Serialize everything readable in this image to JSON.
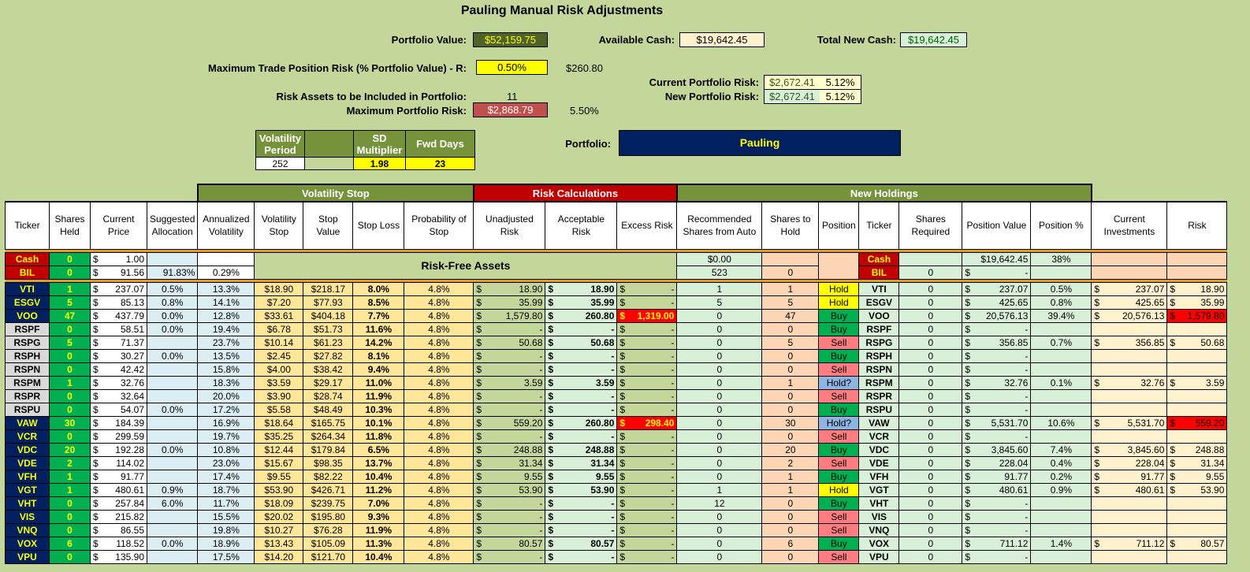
{
  "title": "Pauling Manual Risk Adjustments",
  "colors": {
    "bg": "#c4d79b",
    "dark_green": "#76933c",
    "red": "#c00000",
    "navy": "#002060",
    "yellow": "#ffff00"
  },
  "header": {
    "portfolio_value_label": "Portfolio Value:",
    "portfolio_value": "$52,159.75",
    "available_cash_label": "Available Cash:",
    "available_cash": "$19,642.45",
    "total_new_cash_label": "Total New Cash:",
    "total_new_cash": "$19,642.45",
    "max_trade_label": "Maximum Trade Position Risk (% Portfolio Value) - R:",
    "max_trade_pct": "0.50%",
    "max_trade_amt": "$260.80",
    "current_risk_label": "Current Portfolio Risk:",
    "current_risk": "$2,672.41",
    "current_risk_pct": "5.12%",
    "new_risk_label": "New Portfolio Risk:",
    "new_risk": "$2,672.41",
    "new_risk_pct": "5.12%",
    "risk_assets_label": "Risk Assets to be Included in Portfolio:",
    "risk_assets": "11",
    "max_portfolio_risk_label": "Maximum Portfolio Risk:",
    "max_portfolio_risk": "$2,868.79",
    "max_portfolio_risk_pct": "5.50%",
    "portfolio_label": "Portfolio:",
    "portfolio_name": "Pauling"
  },
  "vol_params": {
    "h1": "Volatility Period",
    "h2": "",
    "h3": "SD Multiplier",
    "h4": "Fwd Days",
    "v1": "252",
    "v2": "",
    "v3": "1.98",
    "v4": "23"
  },
  "groups": {
    "vol_stop": "Volatility Stop",
    "risk_calc": "Risk Calculations",
    "new_holdings": "New Holdings",
    "risk_free": "Risk-Free Assets"
  },
  "columns": [
    "Ticker",
    "Shares Held",
    "Current Price",
    "Suggested Allocation",
    "Annualized Volatility",
    "Volatility Stop",
    "Stop Value",
    "Stop Loss",
    "Probability of Stop",
    "Unadjusted Risk",
    "Acceptable Risk",
    "Excess Risk",
    "Recommended Shares from Auto",
    "Shares to Hold",
    "Position",
    "Ticker",
    "Shares Required",
    "Position Value",
    "Position %",
    "Current Investments",
    "Risk"
  ],
  "cash_row": {
    "ticker": "Cash",
    "held": "0",
    "price": "1.00",
    "rec": "$0.00",
    "pos_value": "$19,642.45",
    "pos_pct": "38%"
  },
  "bil_row": {
    "ticker": "BIL",
    "held": "0",
    "price": "91.56",
    "alloc": "91.83%",
    "vol": "0.29%",
    "rec": "523",
    "hold": "0",
    "req": "0",
    "pos_value": "-"
  },
  "dollar": "$",
  "rows": [
    {
      "t": "VTI",
      "h": "1",
      "p": "237.07",
      "a": "0.5%",
      "v": "13.3%",
      "vs": "$18.90",
      "sv": "$218.17",
      "sl": "8.0%",
      "ps": "4.8%",
      "ur": "18.90",
      "ar": "18.90",
      "er": "-",
      "rs": "1",
      "sh": "1",
      "pos": "Hold",
      "req": "0",
      "pv": "237.07",
      "pp": "0.5%",
      "ci": "237.07",
      "rk": "18.90"
    },
    {
      "t": "ESGV",
      "h": "5",
      "p": "85.13",
      "a": "0.8%",
      "v": "14.1%",
      "vs": "$7.20",
      "sv": "$77.93",
      "sl": "8.5%",
      "ps": "4.8%",
      "ur": "35.99",
      "ar": "35.99",
      "er": "-",
      "rs": "5",
      "sh": "5",
      "pos": "Hold",
      "req": "0",
      "pv": "425.65",
      "pp": "0.8%",
      "ci": "425.65",
      "rk": "35.99"
    },
    {
      "t": "VOO",
      "h": "47",
      "p": "437.79",
      "a": "0.0%",
      "v": "12.8%",
      "vs": "$33.61",
      "sv": "$404.18",
      "sl": "7.7%",
      "ps": "4.8%",
      "ur": "1,579.80",
      "ar": "260.80",
      "er": "1,319.00",
      "rs": "0",
      "sh": "47",
      "pos": "Buy",
      "req": "0",
      "pv": "20,576.13",
      "pp": "39.4%",
      "ci": "20,576.13",
      "rk": "1,579.80"
    },
    {
      "t": "RSPF",
      "h": "0",
      "p": "58.51",
      "a": "0.0%",
      "v": "19.4%",
      "vs": "$6.78",
      "sv": "$51.73",
      "sl": "11.6%",
      "ps": "4.8%",
      "ur": "-",
      "ar": "-",
      "er": "-",
      "rs": "0",
      "sh": "0",
      "pos": "Buy",
      "req": "0",
      "pv": "-",
      "pp": "",
      "ci": "",
      "rk": ""
    },
    {
      "t": "RSPG",
      "h": "5",
      "p": "71.37",
      "a": "",
      "v": "23.7%",
      "vs": "$10.14",
      "sv": "$61.23",
      "sl": "14.2%",
      "ps": "4.8%",
      "ur": "50.68",
      "ar": "50.68",
      "er": "-",
      "rs": "0",
      "sh": "5",
      "pos": "Sell",
      "req": "0",
      "pv": "356.85",
      "pp": "0.7%",
      "ci": "356.85",
      "rk": "50.68"
    },
    {
      "t": "RSPH",
      "h": "0",
      "p": "30.27",
      "a": "0.0%",
      "v": "13.5%",
      "vs": "$2.45",
      "sv": "$27.82",
      "sl": "8.1%",
      "ps": "4.8%",
      "ur": "-",
      "ar": "-",
      "er": "-",
      "rs": "0",
      "sh": "0",
      "pos": "Buy",
      "req": "0",
      "pv": "-",
      "pp": "",
      "ci": "",
      "rk": ""
    },
    {
      "t": "RSPN",
      "h": "0",
      "p": "42.42",
      "a": "",
      "v": "15.8%",
      "vs": "$4.00",
      "sv": "$38.42",
      "sl": "9.4%",
      "ps": "4.8%",
      "ur": "-",
      "ar": "-",
      "er": "-",
      "rs": "0",
      "sh": "0",
      "pos": "Sell",
      "req": "0",
      "pv": "-",
      "pp": "",
      "ci": "",
      "rk": ""
    },
    {
      "t": "RSPM",
      "h": "1",
      "p": "32.76",
      "a": "",
      "v": "18.3%",
      "vs": "$3.59",
      "sv": "$29.17",
      "sl": "11.0%",
      "ps": "4.8%",
      "ur": "3.59",
      "ar": "3.59",
      "er": "-",
      "rs": "0",
      "sh": "1",
      "pos": "Hold?",
      "req": "0",
      "pv": "32.76",
      "pp": "0.1%",
      "ci": "32.76",
      "rk": "3.59"
    },
    {
      "t": "RSPR",
      "h": "0",
      "p": "32.64",
      "a": "",
      "v": "20.0%",
      "vs": "$3.90",
      "sv": "$28.74",
      "sl": "11.9%",
      "ps": "4.8%",
      "ur": "-",
      "ar": "-",
      "er": "-",
      "rs": "0",
      "sh": "0",
      "pos": "Sell",
      "req": "0",
      "pv": "-",
      "pp": "",
      "ci": "",
      "rk": ""
    },
    {
      "t": "RSPU",
      "h": "0",
      "p": "54.07",
      "a": "0.0%",
      "v": "17.2%",
      "vs": "$5.58",
      "sv": "$48.49",
      "sl": "10.3%",
      "ps": "4.8%",
      "ur": "-",
      "ar": "-",
      "er": "-",
      "rs": "0",
      "sh": "0",
      "pos": "Buy",
      "req": "0",
      "pv": "-",
      "pp": "",
      "ci": "",
      "rk": ""
    },
    {
      "t": "VAW",
      "h": "30",
      "p": "184.39",
      "a": "",
      "v": "16.9%",
      "vs": "$18.64",
      "sv": "$165.75",
      "sl": "10.1%",
      "ps": "4.8%",
      "ur": "559.20",
      "ar": "260.80",
      "er": "298.40",
      "rs": "0",
      "sh": "30",
      "pos": "Hold?",
      "req": "0",
      "pv": "5,531.70",
      "pp": "10.6%",
      "ci": "5,531.70",
      "rk": "559.20"
    },
    {
      "t": "VCR",
      "h": "0",
      "p": "299.59",
      "a": "",
      "v": "19.7%",
      "vs": "$35.25",
      "sv": "$264.34",
      "sl": "11.8%",
      "ps": "4.8%",
      "ur": "-",
      "ar": "-",
      "er": "-",
      "rs": "0",
      "sh": "0",
      "pos": "Sell",
      "req": "0",
      "pv": "-",
      "pp": "",
      "ci": "",
      "rk": ""
    },
    {
      "t": "VDC",
      "h": "20",
      "p": "192.28",
      "a": "0.0%",
      "v": "10.8%",
      "vs": "$12.44",
      "sv": "$179.84",
      "sl": "6.5%",
      "ps": "4.8%",
      "ur": "248.88",
      "ar": "248.88",
      "er": "-",
      "rs": "0",
      "sh": "20",
      "pos": "Buy",
      "req": "0",
      "pv": "3,845.60",
      "pp": "7.4%",
      "ci": "3,845.60",
      "rk": "248.88"
    },
    {
      "t": "VDE",
      "h": "2",
      "p": "114.02",
      "a": "",
      "v": "23.0%",
      "vs": "$15.67",
      "sv": "$98.35",
      "sl": "13.7%",
      "ps": "4.8%",
      "ur": "31.34",
      "ar": "31.34",
      "er": "-",
      "rs": "0",
      "sh": "2",
      "pos": "Sell",
      "req": "0",
      "pv": "228.04",
      "pp": "0.4%",
      "ci": "228.04",
      "rk": "31.34"
    },
    {
      "t": "VFH",
      "h": "1",
      "p": "91.77",
      "a": "",
      "v": "17.4%",
      "vs": "$9.55",
      "sv": "$82.22",
      "sl": "10.4%",
      "ps": "4.8%",
      "ur": "9.55",
      "ar": "9.55",
      "er": "-",
      "rs": "0",
      "sh": "1",
      "pos": "Buy",
      "req": "0",
      "pv": "91.77",
      "pp": "0.2%",
      "ci": "91.77",
      "rk": "9.55"
    },
    {
      "t": "VGT",
      "h": "1",
      "p": "480.61",
      "a": "0.9%",
      "v": "18.7%",
      "vs": "$53.90",
      "sv": "$426.71",
      "sl": "11.2%",
      "ps": "4.8%",
      "ur": "53.90",
      "ar": "53.90",
      "er": "-",
      "rs": "1",
      "sh": "1",
      "pos": "Hold",
      "req": "0",
      "pv": "480.61",
      "pp": "0.9%",
      "ci": "480.61",
      "rk": "53.90"
    },
    {
      "t": "VHT",
      "h": "0",
      "p": "257.84",
      "a": "6.0%",
      "v": "11.7%",
      "vs": "$18.09",
      "sv": "$239.75",
      "sl": "7.0%",
      "ps": "4.8%",
      "ur": "-",
      "ar": "-",
      "er": "-",
      "rs": "12",
      "sh": "0",
      "pos": "Buy",
      "req": "0",
      "pv": "-",
      "pp": "",
      "ci": "",
      "rk": ""
    },
    {
      "t": "VIS",
      "h": "0",
      "p": "215.82",
      "a": "",
      "v": "15.5%",
      "vs": "$20.02",
      "sv": "$195.80",
      "sl": "9.3%",
      "ps": "4.8%",
      "ur": "-",
      "ar": "-",
      "er": "-",
      "rs": "0",
      "sh": "0",
      "pos": "Sell",
      "req": "0",
      "pv": "-",
      "pp": "",
      "ci": "",
      "rk": ""
    },
    {
      "t": "VNQ",
      "h": "0",
      "p": "86.55",
      "a": "",
      "v": "19.8%",
      "vs": "$10.27",
      "sv": "$76.28",
      "sl": "11.9%",
      "ps": "4.8%",
      "ur": "-",
      "ar": "-",
      "er": "-",
      "rs": "0",
      "sh": "0",
      "pos": "Sell",
      "req": "0",
      "pv": "-",
      "pp": "",
      "ci": "",
      "rk": ""
    },
    {
      "t": "VOX",
      "h": "6",
      "p": "118.52",
      "a": "0.0%",
      "v": "18.9%",
      "vs": "$13.43",
      "sv": "$105.09",
      "sl": "11.3%",
      "ps": "4.8%",
      "ur": "80.57",
      "ar": "80.57",
      "er": "-",
      "rs": "0",
      "sh": "6",
      "pos": "Buy",
      "req": "0",
      "pv": "711.12",
      "pp": "1.4%",
      "ci": "711.12",
      "rk": "80.57"
    },
    {
      "t": "VPU",
      "h": "0",
      "p": "135.90",
      "a": "",
      "v": "17.5%",
      "vs": "$14.20",
      "sv": "$121.70",
      "sl": "10.4%",
      "ps": "4.8%",
      "ur": "-",
      "ar": "-",
      "er": "-",
      "rs": "0",
      "sh": "0",
      "pos": "Sell",
      "req": "0",
      "pv": "-",
      "pp": "",
      "ci": "",
      "rk": ""
    }
  ]
}
